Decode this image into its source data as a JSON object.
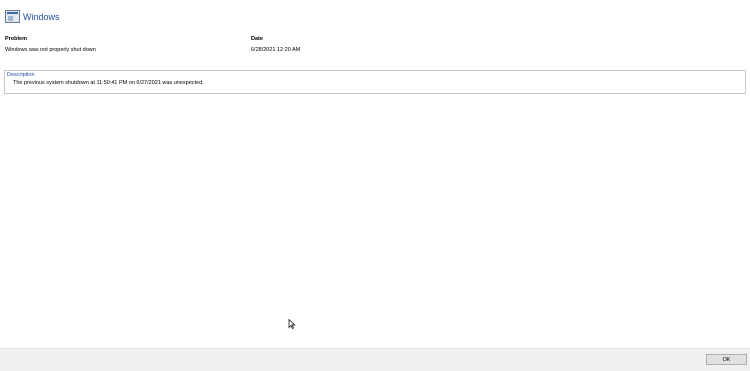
{
  "header": {
    "title": "Windows",
    "icon": "window-app-icon"
  },
  "columns": {
    "problem_label": "Problem",
    "problem_value": "Windows was not properly shut down",
    "date_label": "Date",
    "date_value": "6/28/2021 12:20 AM"
  },
  "description": {
    "label": "Description",
    "text": "The previous system shutdown at 11:50:41 PM on 6/27/2021 was unexpected."
  },
  "footer": {
    "ok_label": "OK"
  },
  "colors": {
    "accent": "#1e4e9c",
    "footer_bg": "#f0f0f0",
    "border": "#c8c8c8"
  }
}
